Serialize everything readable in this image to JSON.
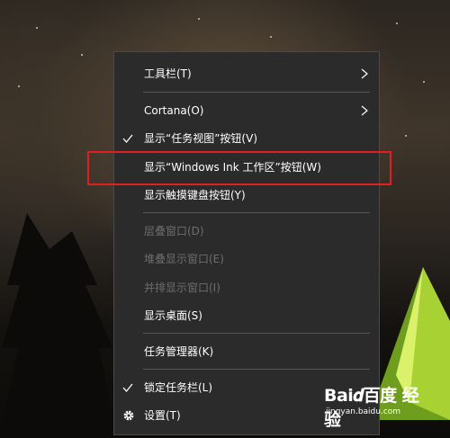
{
  "menu": {
    "items": [
      {
        "label": "工具栏(T)",
        "has_submenu": true,
        "checked": false,
        "disabled": false
      },
      {
        "label": "Cortana(O)",
        "has_submenu": true,
        "checked": false,
        "disabled": false
      },
      {
        "label": "显示“任务视图”按钮(V)",
        "has_submenu": false,
        "checked": true,
        "disabled": false
      },
      {
        "label": "显示“Windows Ink 工作区”按钮(W)",
        "has_submenu": false,
        "checked": false,
        "disabled": false,
        "highlighted": true
      },
      {
        "label": "显示触摸键盘按钮(Y)",
        "has_submenu": false,
        "checked": false,
        "disabled": false
      },
      {
        "label": "层叠窗口(D)",
        "has_submenu": false,
        "checked": false,
        "disabled": true
      },
      {
        "label": "堆叠显示窗口(E)",
        "has_submenu": false,
        "checked": false,
        "disabled": true
      },
      {
        "label": "并排显示窗口(I)",
        "has_submenu": false,
        "checked": false,
        "disabled": true
      },
      {
        "label": "显示桌面(S)",
        "has_submenu": false,
        "checked": false,
        "disabled": false
      },
      {
        "label": "任务管理器(K)",
        "has_submenu": false,
        "checked": false,
        "disabled": false
      },
      {
        "label": "锁定任务栏(L)",
        "has_submenu": false,
        "checked": true,
        "disabled": false
      },
      {
        "label": "设置(T)",
        "has_submenu": false,
        "checked": false,
        "disabled": false,
        "icon": "gear-icon"
      }
    ]
  },
  "highlight_color": "#e51d20",
  "watermark": {
    "logo": "Bai𝒅百度 经验",
    "url": "jingyan.baidu.com"
  }
}
